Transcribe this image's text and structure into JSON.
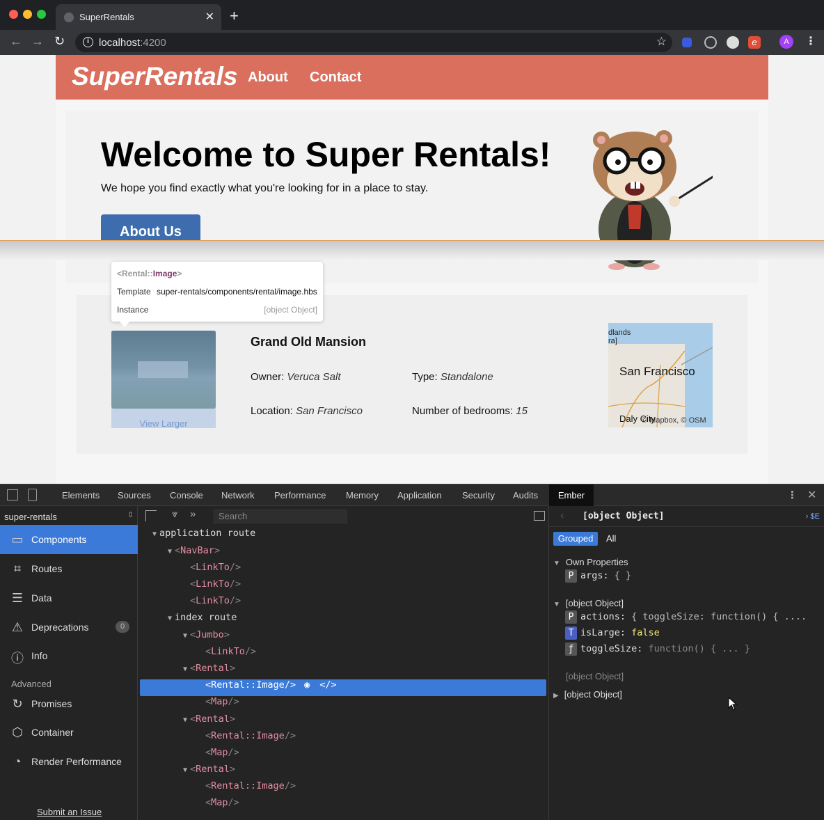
{
  "browser": {
    "tab_title": "SuperRentals",
    "url_host": "localhost",
    "url_port": ":4200"
  },
  "site": {
    "brand": "SuperRentals",
    "nav_links": [
      "About",
      "Contact"
    ],
    "welcome_heading": "Welcome to Super Rentals!",
    "welcome_text": "We hope you find exactly what you're looking for in a place to stay.",
    "about_button": "About Us"
  },
  "rental": {
    "title": "Grand Old Mansion",
    "owner_label": "Owner:",
    "owner": "Veruca Salt",
    "type_label": "Type:",
    "type": "Standalone",
    "location_label": "Location:",
    "location": "San Francisco",
    "bedrooms_label": "Number of bedrooms:",
    "bedrooms": "15",
    "view_larger": "View Larger",
    "map": {
      "city": "San Francisco",
      "area_top": "dlands",
      "area_top2": "ra]",
      "daly": "Daly City",
      "attribution": "© Mapbox, © OSM"
    }
  },
  "tooltip": {
    "tag_open": "<Rental::",
    "tag_name": "Image",
    "tag_close": ">",
    "template_label": "Template",
    "template_value": "super-rentals/components/rental/image.hbs",
    "instance_label": "Instance",
    "instance_value": "[object Object]"
  },
  "devtools": {
    "tabs": [
      "Elements",
      "Sources",
      "Console",
      "Network",
      "Performance",
      "Memory",
      "Application",
      "Security",
      "Audits"
    ],
    "ember_tab": "Ember",
    "app_select": "super-rentals",
    "sidebar": [
      {
        "label": "Components",
        "icon": "components-icon"
      },
      {
        "label": "Routes",
        "icon": "routes-icon"
      },
      {
        "label": "Data",
        "icon": "data-icon"
      },
      {
        "label": "Deprecations",
        "icon": "warning-icon"
      },
      {
        "label": "Info",
        "icon": "info-icon"
      }
    ],
    "deprecations_count": "0",
    "advanced_label": "Advanced",
    "advanced": [
      {
        "label": "Promises",
        "icon": "promise-icon"
      },
      {
        "label": "Container",
        "icon": "container-icon"
      },
      {
        "label": "Render Performance",
        "icon": "performance-icon"
      }
    ],
    "submit_issue": "Submit an Issue",
    "search_placeholder": "Search",
    "tree": {
      "application_route": "application route",
      "navbar": "NavBar",
      "linkto": "LinkTo",
      "index_route": "index route",
      "jumbo": "Jumbo",
      "rental": "Rental",
      "rental_image": "Rental::Image",
      "map": "Map"
    },
    "inspector": {
      "title": "[object Object]",
      "se": "$E",
      "grouped": "Grouped",
      "all": "All",
      "own_properties": "Own Properties",
      "args_key": "args:",
      "args_val": "{ }",
      "obj_section": "[object Object]",
      "actions_key": "actions:",
      "actions_val": "{ toggleSize: function() { ....",
      "islarge_key": "isLarge:",
      "islarge_val": "false",
      "togglesize_key": "toggleSize:",
      "togglesize_val": "function() { ... }",
      "obj_section2": "[object Object]",
      "obj_section3": "[object Object]"
    }
  }
}
